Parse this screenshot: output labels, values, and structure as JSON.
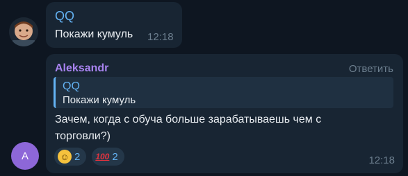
{
  "messages": [
    {
      "sender": "QQ",
      "text": "Покажи кумуль",
      "time": "12:18",
      "avatar": "user-photo"
    },
    {
      "sender": "Aleksandr",
      "avatar_letter": "A",
      "reply_action": "Ответить",
      "quote": {
        "sender": "QQ",
        "text": "Покажи кумуль"
      },
      "text_line1": "Зачем, когда с обуча больше зарабатываешь чем с",
      "text_line2": "торговли?)",
      "reactions": [
        {
          "emoji": "grinning-face",
          "count": "2"
        },
        {
          "emoji": "hundred-points",
          "count": "2"
        }
      ],
      "time": "12:18"
    }
  ],
  "colors": {
    "background": "#0e1621",
    "bubble": "#182533",
    "accent_blue": "#64b3f4",
    "accent_purple": "#a883f0"
  }
}
